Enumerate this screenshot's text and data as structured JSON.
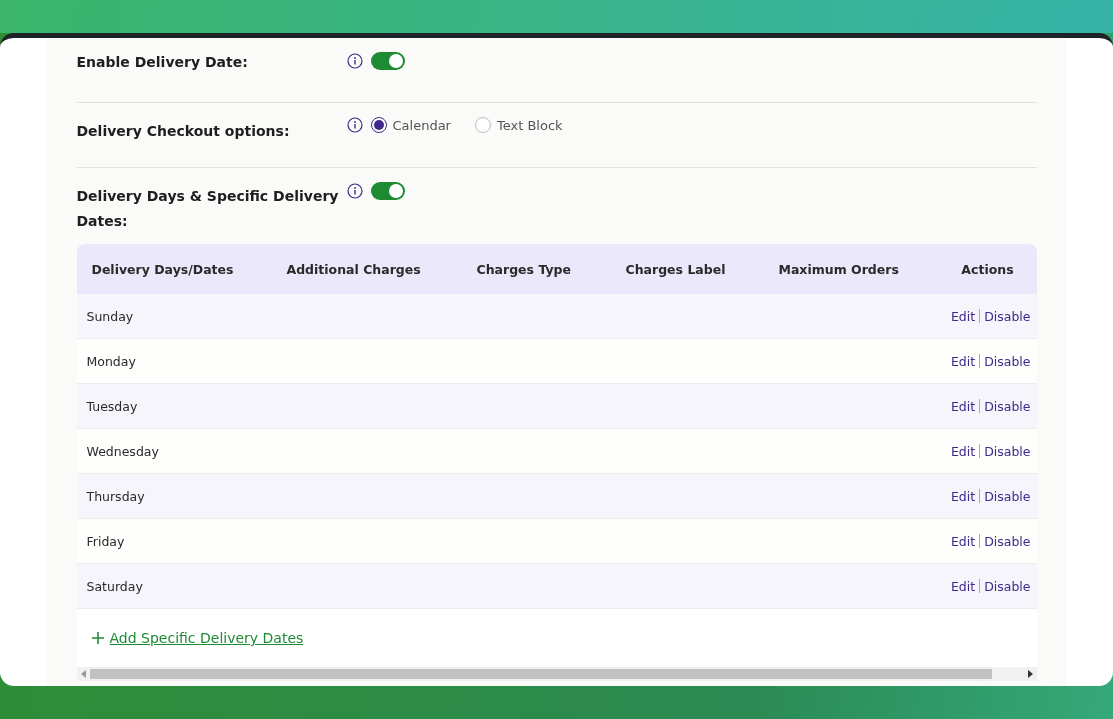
{
  "settings": [
    {
      "kind": "toggle",
      "label": "Enable Delivery Date:",
      "on": true
    },
    {
      "kind": "radio",
      "label": "Delivery Checkout options:",
      "options": [
        {
          "label": "Calendar",
          "selected": true
        },
        {
          "label": "Text Block",
          "selected": false
        }
      ]
    },
    {
      "kind": "toggle",
      "label": "Delivery Days & Specific Delivery Dates:",
      "on": true
    }
  ],
  "table": {
    "columns": [
      "Delivery Days/Dates",
      "Additional Charges",
      "Charges Type",
      "Charges Label",
      "Maximum Orders",
      "Actions"
    ],
    "rows": [
      {
        "day": "Sunday",
        "edit": "Edit",
        "disable": "Disable"
      },
      {
        "day": "Monday",
        "edit": "Edit",
        "disable": "Disable"
      },
      {
        "day": "Tuesday",
        "edit": "Edit",
        "disable": "Disable"
      },
      {
        "day": "Wednesday",
        "edit": "Edit",
        "disable": "Disable"
      },
      {
        "day": "Thursday",
        "edit": "Edit",
        "disable": "Disable"
      },
      {
        "day": "Friday",
        "edit": "Edit",
        "disable": "Disable"
      },
      {
        "day": "Saturday",
        "edit": "Edit",
        "disable": "Disable"
      }
    ]
  },
  "add_link": "Add Specific Delivery Dates"
}
